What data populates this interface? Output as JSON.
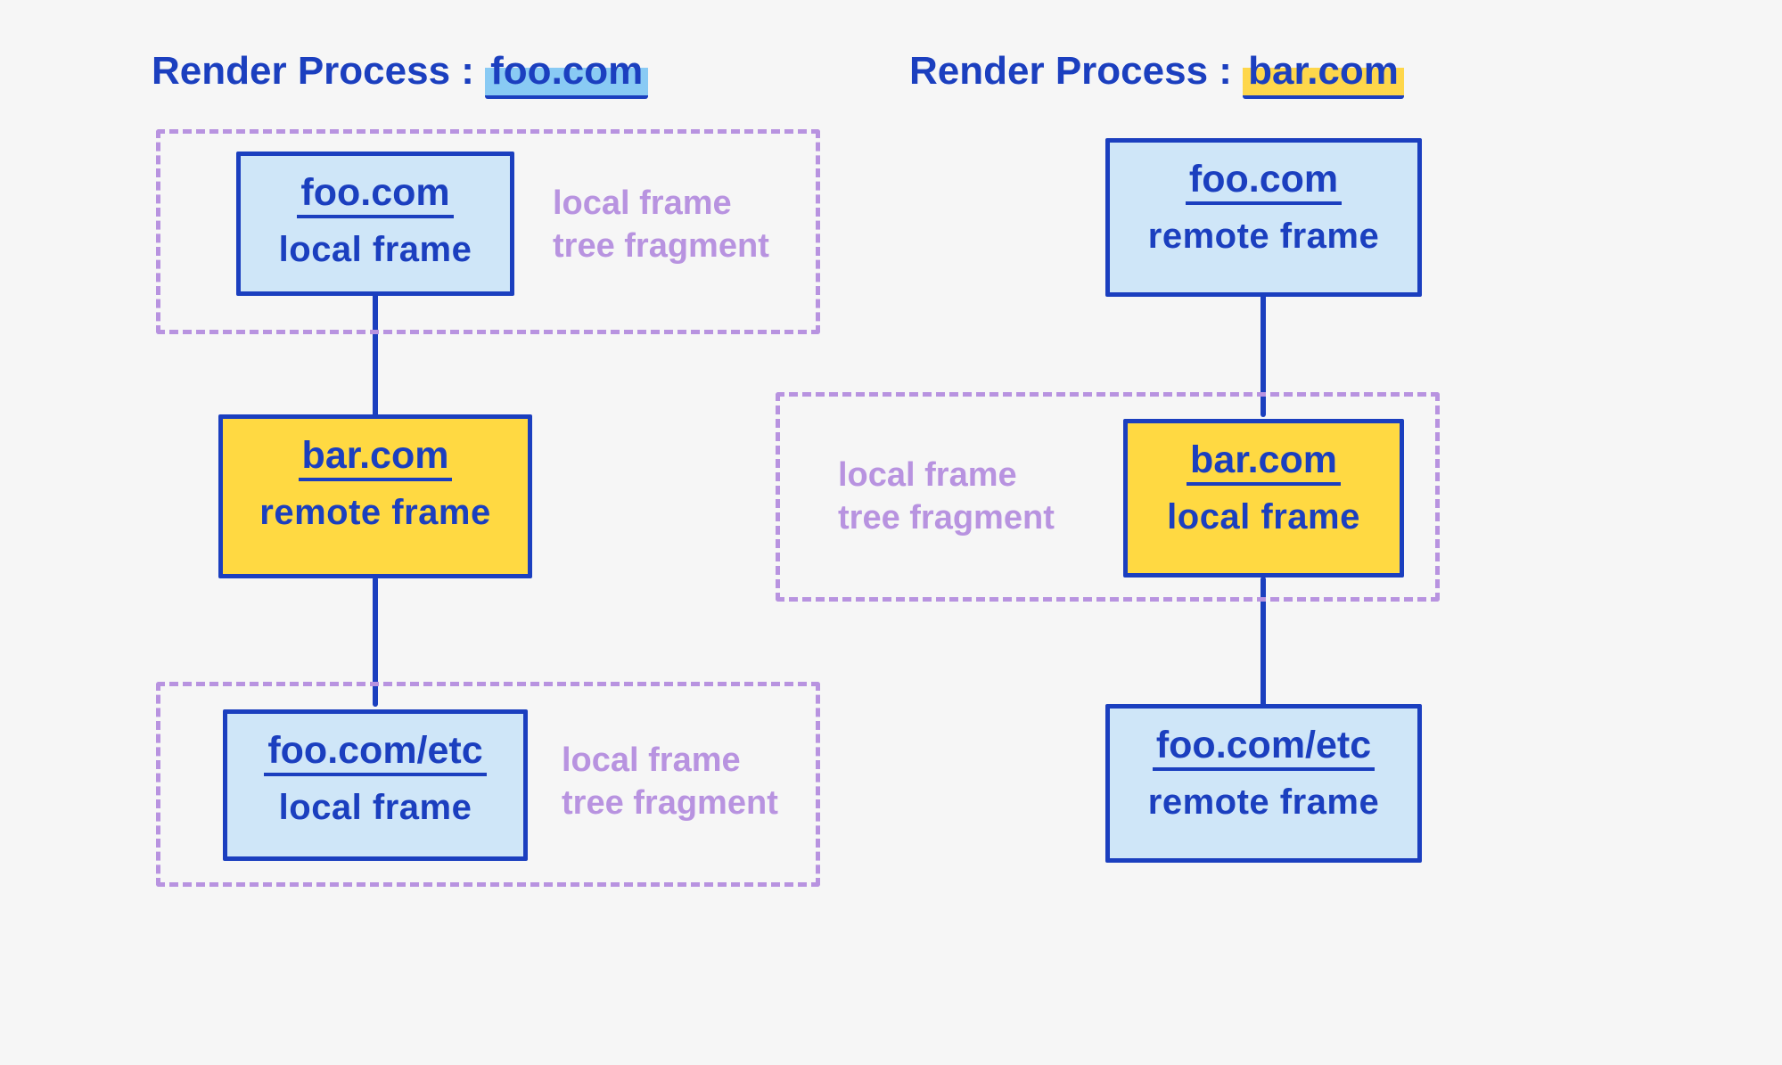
{
  "left": {
    "title_prefix": "Render Process : ",
    "title_domain": "foo.com",
    "nodes": [
      {
        "site": "foo.com",
        "role": "local frame"
      },
      {
        "site": "bar.com",
        "role": "remote frame"
      },
      {
        "site": "foo.com/etc",
        "role": "local frame"
      }
    ],
    "fragment_label": "local frame\ntree fragment"
  },
  "right": {
    "title_prefix": "Render Process : ",
    "title_domain": "bar.com",
    "nodes": [
      {
        "site": "foo.com",
        "role": "remote frame"
      },
      {
        "site": "bar.com",
        "role": "local frame"
      },
      {
        "site": "foo.com/etc",
        "role": "remote frame"
      }
    ],
    "fragment_label": "local frame\ntree fragment"
  },
  "colors": {
    "ink": "#1b3fbf",
    "dash": "#b893e0",
    "blue_fill": "#cfe6f8",
    "yellow_fill": "#ffd942",
    "bg": "#f6f6f6"
  }
}
